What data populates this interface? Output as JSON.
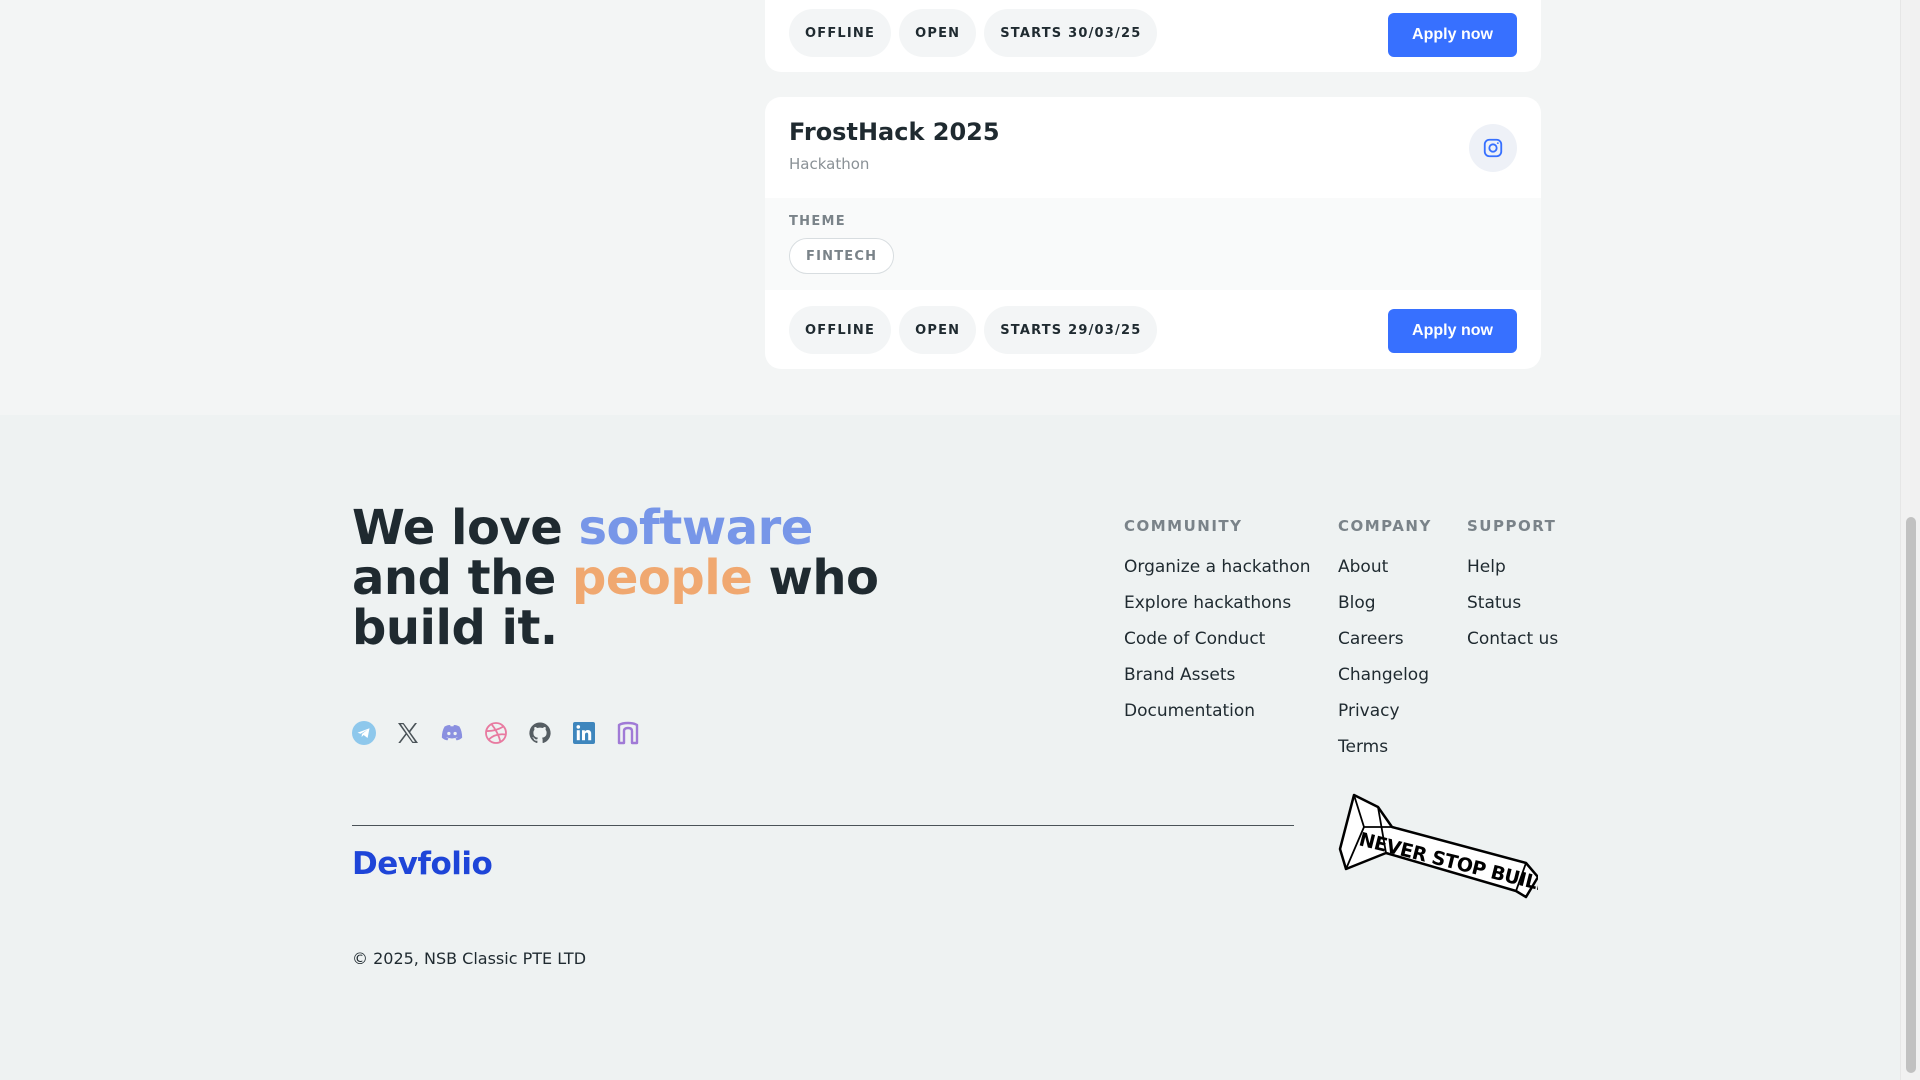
{
  "cards": [
    {
      "chips": [
        "OFFLINE",
        "OPEN",
        "STARTS 30/03/25"
      ],
      "apply_label": "Apply now"
    },
    {
      "title": "FrostHack 2025",
      "subtitle": "Hackathon",
      "theme_label": "THEME",
      "theme": "FINTECH",
      "chips": [
        "OFFLINE",
        "OPEN",
        "STARTS 29/03/25"
      ],
      "apply_label": "Apply now",
      "social_icon": "instagram-icon"
    }
  ],
  "footer": {
    "tagline": {
      "part1": "We love ",
      "highlight1": "software",
      "part2": "and the ",
      "highlight2": "people",
      "part3": " who",
      "part4": "build it."
    },
    "social_icons": [
      "telegram-icon",
      "x-icon",
      "discord-icon",
      "dribbble-icon",
      "github-icon",
      "linkedin-icon",
      "devfolio-arch-icon"
    ],
    "columns": [
      {
        "heading": "COMMUNITY",
        "links": [
          "Organize a hackathon",
          "Explore hackathons",
          "Code of Conduct",
          "Brand Assets",
          "Documentation"
        ]
      },
      {
        "heading": "COMPANY",
        "links": [
          "About",
          "Blog",
          "Careers",
          "Changelog",
          "Privacy",
          "Terms"
        ]
      },
      {
        "heading": "SUPPORT",
        "links": [
          "Help",
          "Status",
          "Contact us"
        ]
      }
    ],
    "brand": "Devfolio",
    "copyright": "© 2025, NSB Classic PTE LTD",
    "logo_text": "NEVER STOP BUILDING"
  },
  "colors": {
    "accent": "#3770ff",
    "brand": "#1e45d8",
    "highlight_blue": "#7796e8",
    "highlight_orange": "#f0a870"
  }
}
